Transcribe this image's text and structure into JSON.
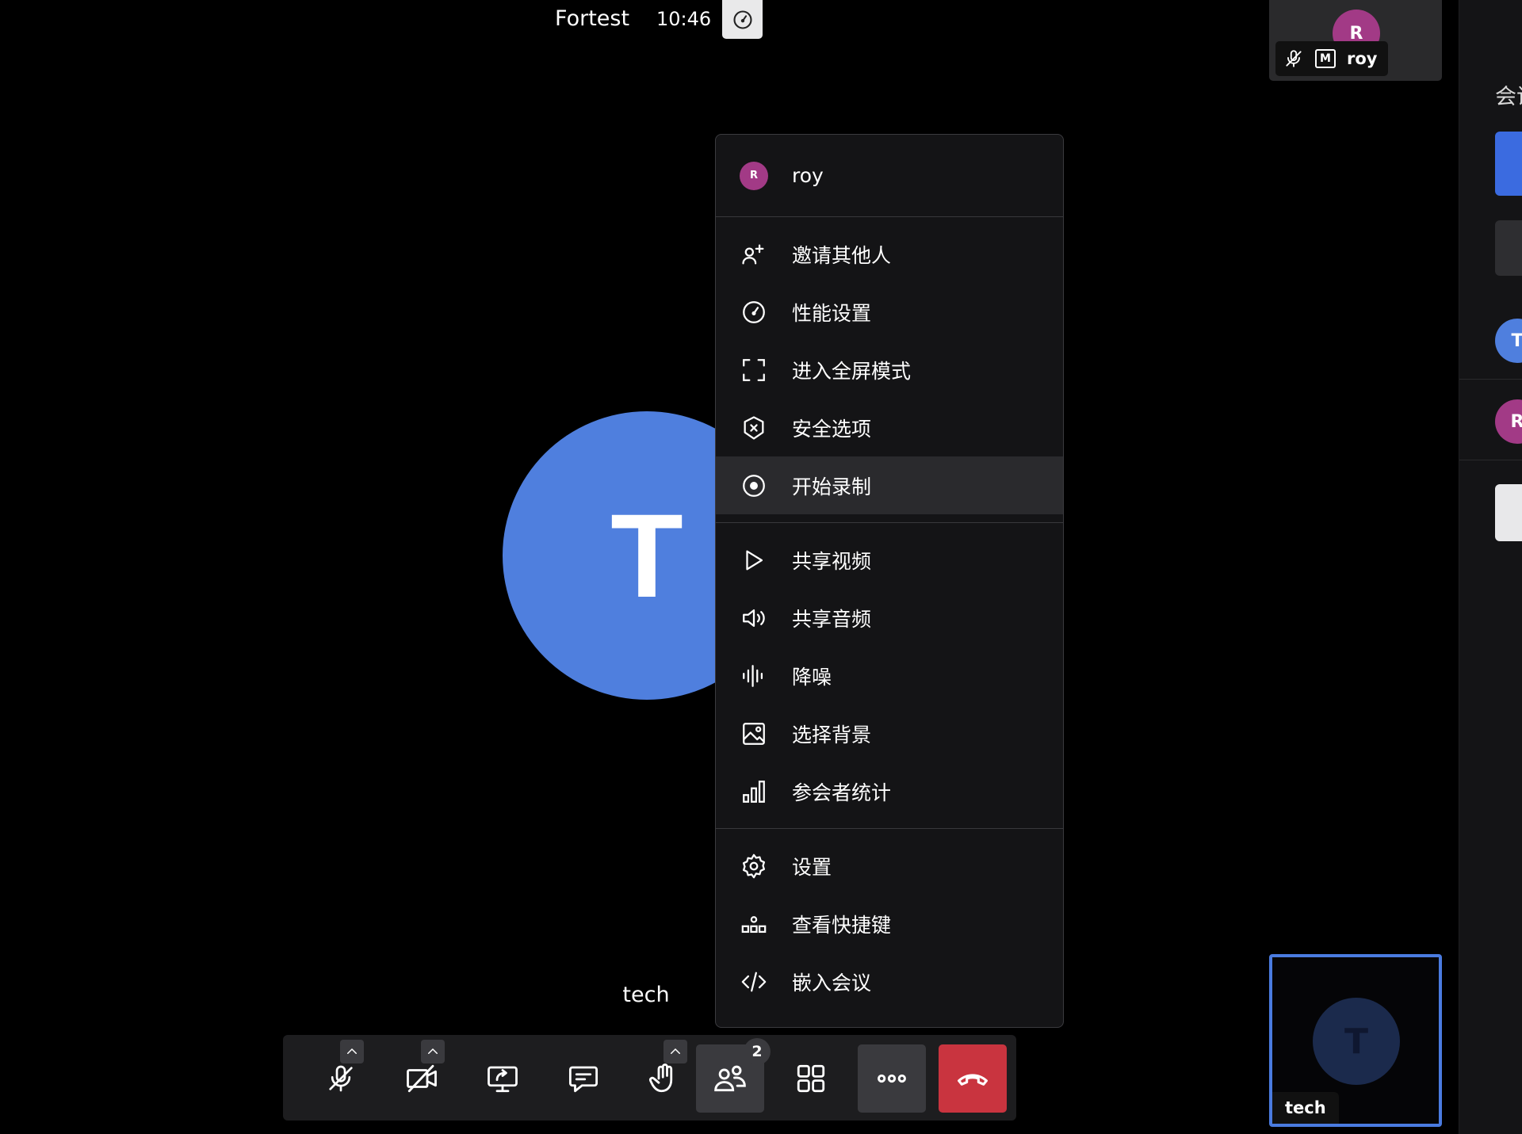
{
  "topbar": {
    "room_name": "Fortest",
    "clock": "10:46"
  },
  "stage": {
    "avatar_letter": "T",
    "participant_name": "tech",
    "avatar_color": "#4f7fde"
  },
  "thumb_top": {
    "avatar_letter": "R",
    "name": "roy",
    "moderator_badge": "M",
    "avatar_color": "#a23a86"
  },
  "thumb_bottom": {
    "avatar_letter": "T",
    "name": "tech",
    "border_color": "#4a7be0"
  },
  "side_panel": {
    "title": "会议",
    "avatar_t": "T",
    "avatar_r": "R"
  },
  "menu": {
    "user": {
      "avatar_letter": "R",
      "name": "roy"
    },
    "items": [
      {
        "label": "邀请其他人",
        "icon": "invite-icon"
      },
      {
        "label": "性能设置",
        "icon": "gauge-icon"
      },
      {
        "label": "进入全屏模式",
        "icon": "fullscreen-icon"
      },
      {
        "label": "安全选项",
        "icon": "shield-icon"
      },
      {
        "label": "开始录制",
        "icon": "record-icon",
        "highlighted": true
      },
      {
        "label": "共享视频",
        "icon": "play-icon"
      },
      {
        "label": "共享音频",
        "icon": "speaker-icon"
      },
      {
        "label": "降噪",
        "icon": "noise-suppression-icon"
      },
      {
        "label": "选择背景",
        "icon": "image-icon"
      },
      {
        "label": "参会者统计",
        "icon": "bar-chart-icon"
      },
      {
        "label": "设置",
        "icon": "gear-icon"
      },
      {
        "label": "查看快捷键",
        "icon": "shortcuts-icon"
      },
      {
        "label": "嵌入会议",
        "icon": "code-icon"
      }
    ]
  },
  "toolbar": {
    "participants_count": "2",
    "buttons": [
      "mic-muted-icon",
      "camera-off-icon",
      "screen-share-icon",
      "chat-icon",
      "raise-hand-icon",
      "participants-icon",
      "tile-view-icon",
      "more-icon",
      "hangup-icon"
    ]
  },
  "colors": {
    "accent": "#4a7be0",
    "hangup": "#c9343f",
    "moderator_avatar": "#a23a86"
  }
}
